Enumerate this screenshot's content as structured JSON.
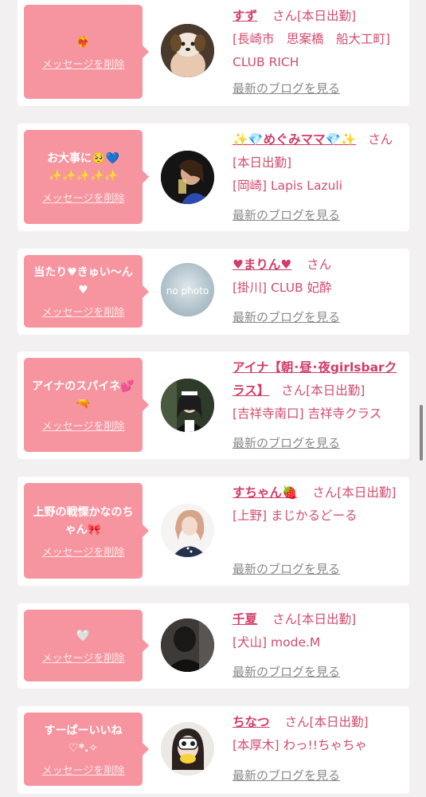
{
  "delete_label": "メッセージを削除",
  "blog_label": "最新のブログを見る",
  "san_suffix": "さん",
  "cards": [
    {
      "message": "❤️‍🔥",
      "name": "すず",
      "status": "[本日出勤]",
      "shop": "[長崎市　思案橋　船大工町] CLUB RICH",
      "avatar_icon": "dog-face-photo"
    },
    {
      "message": "お大事に🥺💙✨✨✨✨✨",
      "name": "✨💎めぐみママ💎✨",
      "status": "[本日出勤]",
      "shop": "[岡崎] Lapis Lazuli",
      "avatar_icon": "woman-with-glass-photo"
    },
    {
      "message": "当たり♥きゅい〜ん♥",
      "name": "♥まりん♥",
      "status": "",
      "shop": "[掛川] CLUB 妃酔",
      "avatar_icon": "no-photo",
      "avatar_text": "no photo"
    },
    {
      "message": "アイナのスパイネ💕🔫",
      "name": "アイナ【朝･昼･夜girlsbarクラス】",
      "status": "[本日出勤]",
      "shop": "[吉祥寺南口] 吉祥寺クラス",
      "avatar_icon": "maid-girl-photo"
    },
    {
      "message": "上野の戦慄かなのちゃん🎀",
      "name": "すちゃん🍓",
      "status": "[本日出勤]",
      "shop": "[上野] まじかるどーる",
      "avatar_icon": "girl-photo"
    },
    {
      "message": "🤍",
      "name": "千夏",
      "status": "[本日出勤]",
      "shop": "[犬山] mode.M",
      "avatar_icon": "silhouette-photo"
    },
    {
      "message": "すーぱーいいね♡*.✧",
      "name": "ちなつ",
      "status": "[本日出勤]",
      "shop": "[本厚木] わっ!!ちゃちゃ",
      "avatar_icon": "masked-girl-photo"
    }
  ]
}
